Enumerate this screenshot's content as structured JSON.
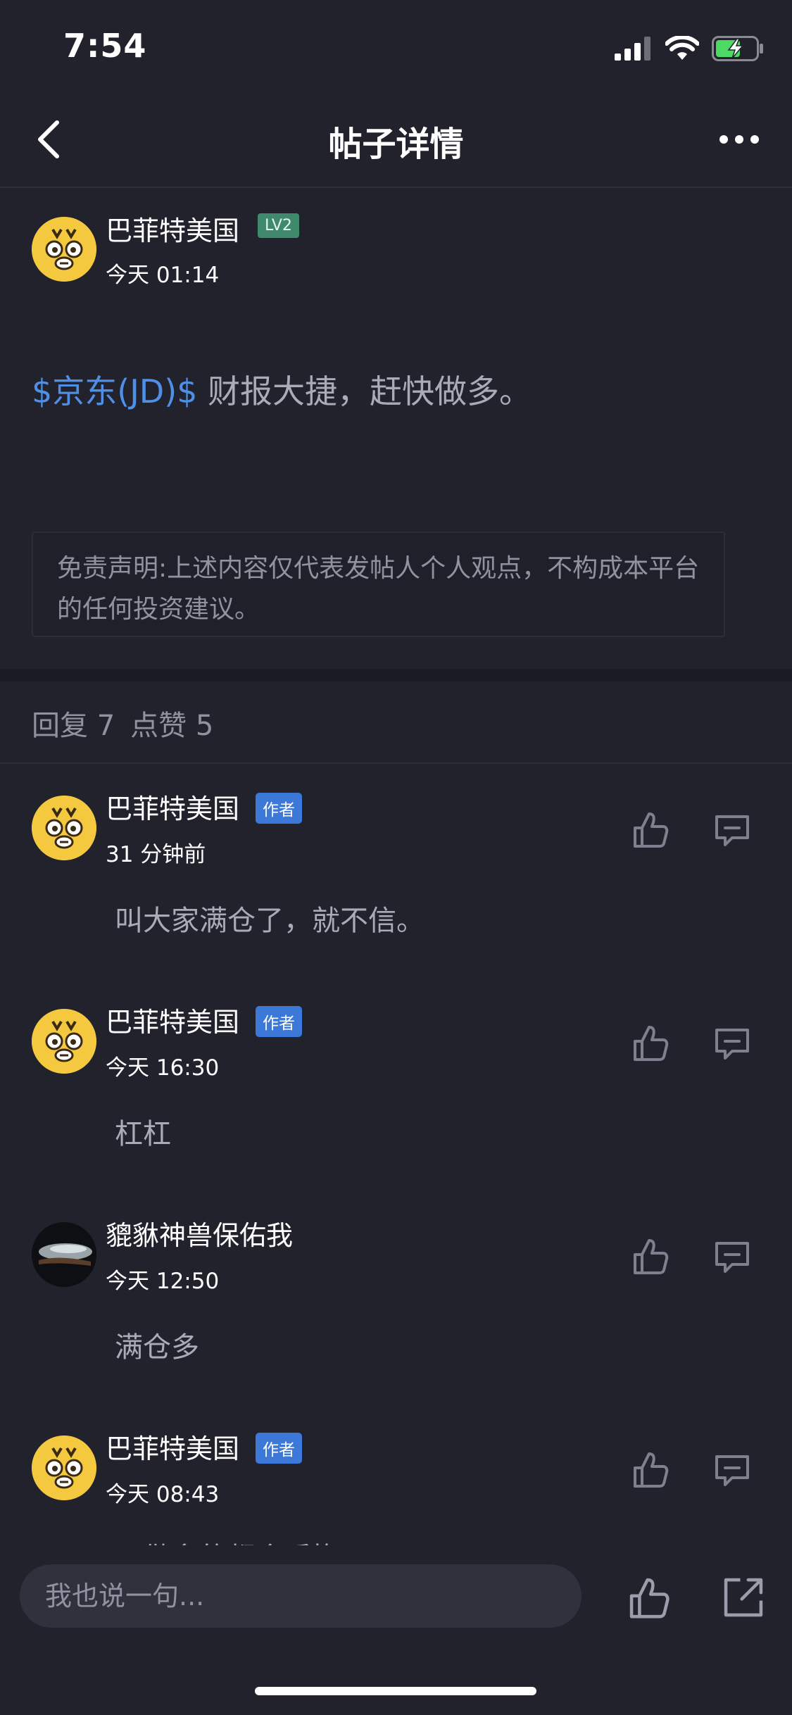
{
  "status_bar": {
    "time": "7:54",
    "icons": [
      "signal-icon",
      "wifi-icon",
      "battery-charging-icon"
    ],
    "battery_color": "#4cd964"
  },
  "nav": {
    "title": "帖子详情",
    "back_icon": "chevron-left-icon",
    "more_icon": "more-dots-icon"
  },
  "post": {
    "author": "巴菲特美国",
    "level_badge": "LV2",
    "time": "今天 01:14",
    "stock_tag": "$京东(JD)$",
    "content": " 财报大捷，赶快做多。",
    "disclaimer": "免责声明:上述内容仅代表发帖人个人观点，不构成本平台的任何投资建议。",
    "accent_color": "#4f8fe6"
  },
  "stats": {
    "replies": "回复 7",
    "likes": "点赞 5"
  },
  "replies": [
    {
      "author": "巴菲特美国",
      "badge": "作者",
      "time": "31 分钟前",
      "text": "叫大家满仓了，就不信。",
      "avatar": "tiger"
    },
    {
      "author": "巴菲特美国",
      "badge": "作者",
      "time": "今天 16:30",
      "text": "杠杠",
      "avatar": "tiger"
    },
    {
      "author": "貔貅神兽保佑我",
      "badge": "",
      "time": "今天 12:50",
      "text": "满仓多",
      "avatar": "dark"
    },
    {
      "author": "巴菲特美国",
      "badge": "作者",
      "time": "今天 08:43",
      "text": "不做多的都会后悔",
      "avatar": "tiger"
    }
  ],
  "bottom": {
    "input_placeholder": "我也说一句..."
  }
}
